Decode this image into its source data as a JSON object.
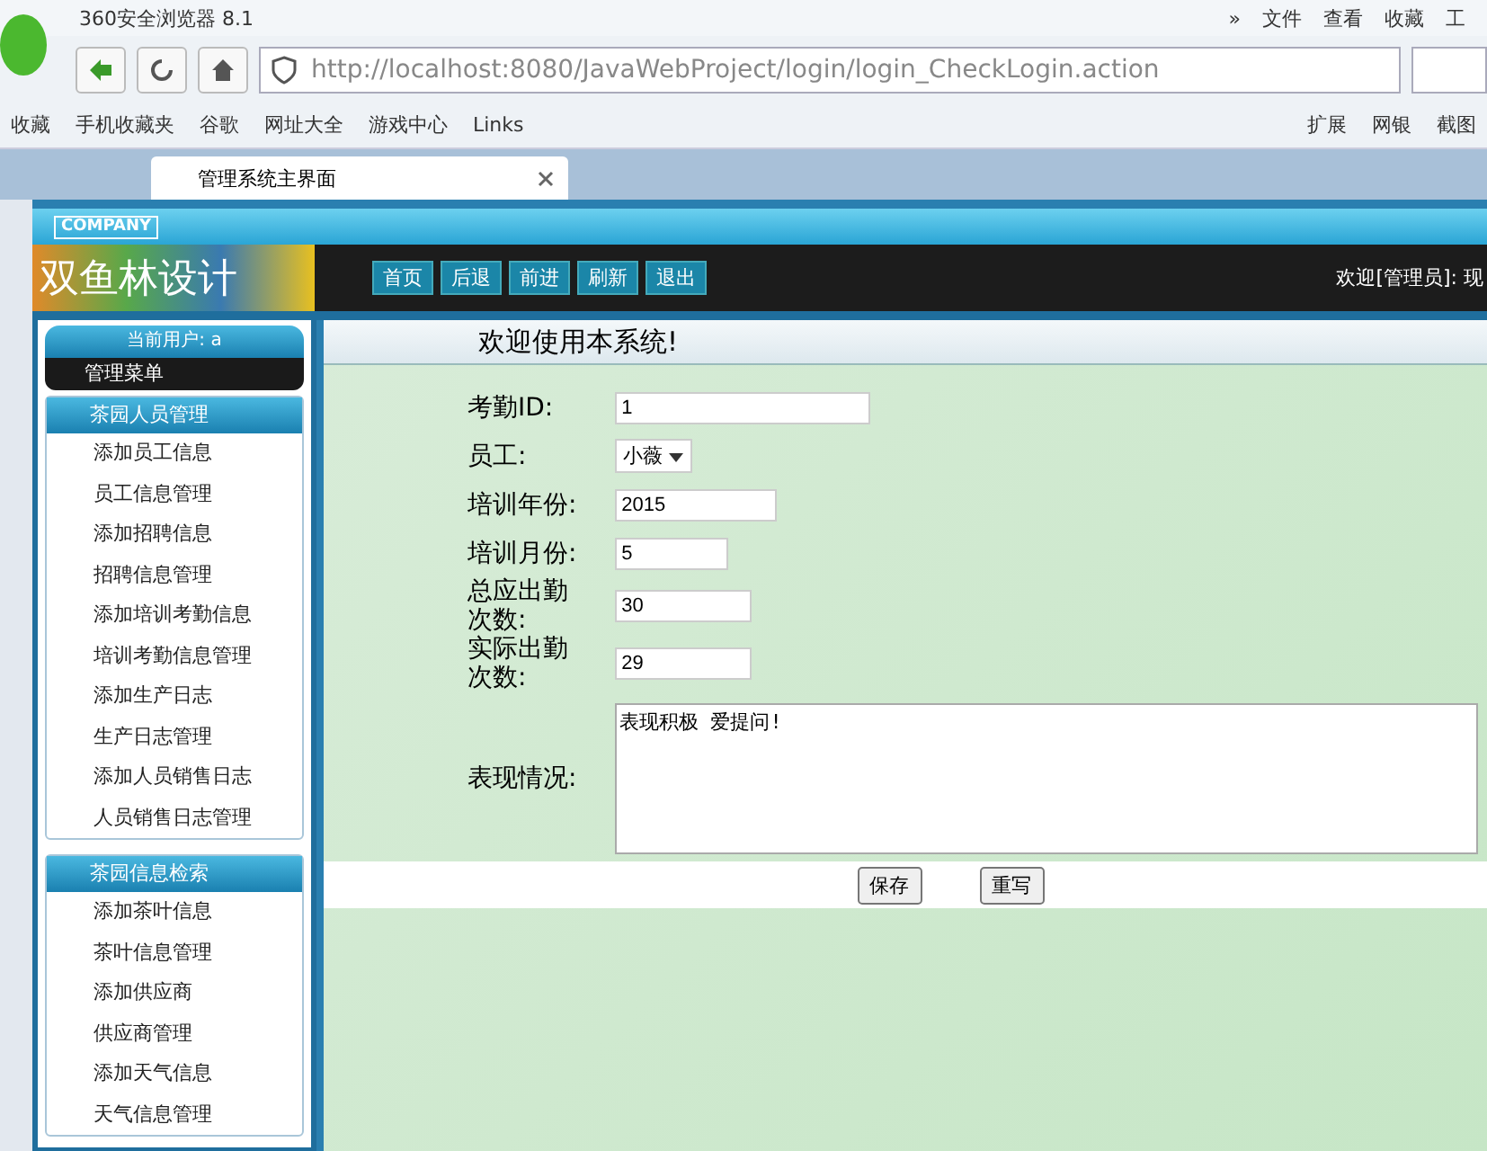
{
  "browser": {
    "title": "360安全浏览器 8.1",
    "menu": [
      "»",
      "文件",
      "查看",
      "收藏",
      "工"
    ],
    "url": "http://localhost:8080/JavaWebProject/login/login_CheckLogin.action",
    "bookmarks": [
      "收藏",
      "手机收藏夹",
      "谷歌",
      "网址大全",
      "游戏中心",
      "Links"
    ],
    "tools": [
      "扩展",
      "网银",
      "截图"
    ],
    "tabs": [
      {
        "label": "管理系统主界面",
        "selected": true
      }
    ]
  },
  "header": {
    "company": "COMPANY",
    "logo": "双鱼林设计",
    "nav": [
      "首页",
      "后退",
      "前进",
      "刷新",
      "退出"
    ],
    "welcome": "欢迎[管理员]: 现"
  },
  "sidebar": {
    "user": "当前用户: a",
    "menu_title": "管理菜单",
    "groups": [
      {
        "title": "茶园人员管理",
        "items": [
          "添加员工信息",
          "员工信息管理",
          "添加招聘信息",
          "招聘信息管理",
          "添加培训考勤信息",
          "培训考勤信息管理",
          "添加生产日志",
          "生产日志管理",
          "添加人员销售日志",
          "人员销售日志管理"
        ]
      },
      {
        "title": "茶园信息检索",
        "items": [
          "添加茶叶信息",
          "茶叶信息管理",
          "添加供应商",
          "供应商管理",
          "添加天气信息",
          "天气信息管理"
        ]
      }
    ]
  },
  "content": {
    "title": "欢迎使用本系统!",
    "fields": [
      {
        "label": "考勤ID:",
        "kind": "text",
        "value": "1"
      },
      {
        "label": "员工:",
        "kind": "select",
        "value": "小薇"
      },
      {
        "label": "培训年份:",
        "kind": "text",
        "value": "2015"
      },
      {
        "label": "培训月份:",
        "kind": "text",
        "value": "5"
      },
      {
        "label": "总应出勤次数:",
        "kind": "text",
        "value": "30"
      },
      {
        "label": "实际出勤次数:",
        "kind": "text",
        "value": "29"
      },
      {
        "label": "表现情况:",
        "kind": "textarea",
        "value": "表现积极 爱提问!"
      }
    ],
    "buttons": [
      "保存",
      "重写"
    ]
  }
}
